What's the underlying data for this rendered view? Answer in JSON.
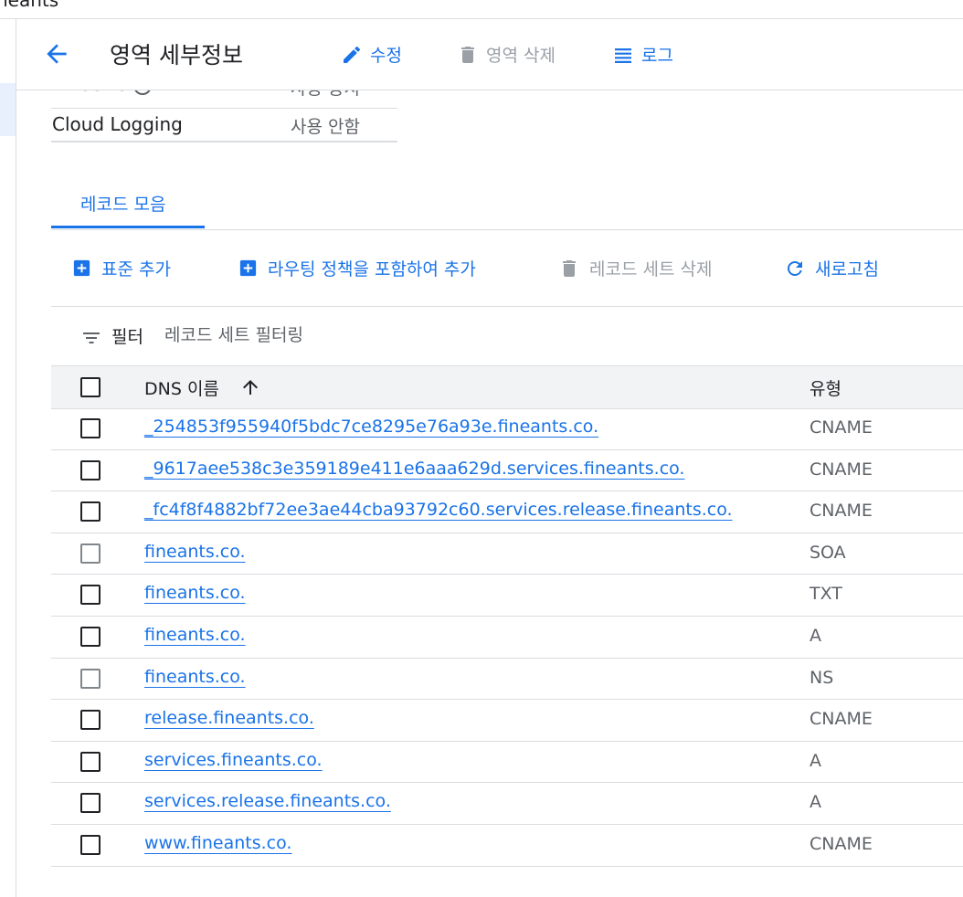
{
  "window": {
    "partial_title": "neants"
  },
  "header": {
    "title": "영역 세부정보",
    "actions": {
      "edit": "수정",
      "delete_zone": "영역 삭제",
      "logs": "로그"
    }
  },
  "details": [
    {
      "key": "DNSSEC",
      "value": "사용 중지"
    },
    {
      "key": "Cloud Logging",
      "value": "사용 안함"
    }
  ],
  "tabs": {
    "record_sets": "레코드 모음"
  },
  "toolbar": {
    "add_standard": "표준 추가",
    "add_with_routing": "라우팅 정책을 포함하여 추가",
    "delete_record_sets": "레코드 세트 삭제",
    "refresh": "새로고침"
  },
  "filter": {
    "label": "필터",
    "placeholder": "레코드 세트 필터링"
  },
  "table": {
    "columns": {
      "name": "DNS 이름",
      "type": "유형"
    },
    "sort": "ascending",
    "rows": [
      {
        "name": "_254853f955940f5bdc7ce8295e76a93e.fineants.co.",
        "type": "CNAME",
        "checkbox_enabled": true
      },
      {
        "name": "_9617aee538c3e359189e411e6aaa629d.services.fineants.co.",
        "type": "CNAME",
        "checkbox_enabled": true
      },
      {
        "name": "_fc4f8f4882bf72ee3ae44cba93792c60.services.release.fineants.co.",
        "type": "CNAME",
        "checkbox_enabled": true
      },
      {
        "name": "fineants.co.",
        "type": "SOA",
        "checkbox_enabled": false
      },
      {
        "name": "fineants.co.",
        "type": "TXT",
        "checkbox_enabled": true
      },
      {
        "name": "fineants.co.",
        "type": "A",
        "checkbox_enabled": true
      },
      {
        "name": "fineants.co.",
        "type": "NS",
        "checkbox_enabled": false
      },
      {
        "name": "release.fineants.co.",
        "type": "CNAME",
        "checkbox_enabled": true
      },
      {
        "name": "services.fineants.co.",
        "type": "A",
        "checkbox_enabled": true
      },
      {
        "name": "services.release.fineants.co.",
        "type": "A",
        "checkbox_enabled": true
      },
      {
        "name": "www.fineants.co.",
        "type": "CNAME",
        "checkbox_enabled": true
      }
    ]
  },
  "colors": {
    "accent": "#1a73e8",
    "disabled": "#9aa0a6",
    "text": "#202124",
    "secondary_text": "#5f6368",
    "divider": "#dadce0",
    "header_bg": "#f1f3f4"
  }
}
